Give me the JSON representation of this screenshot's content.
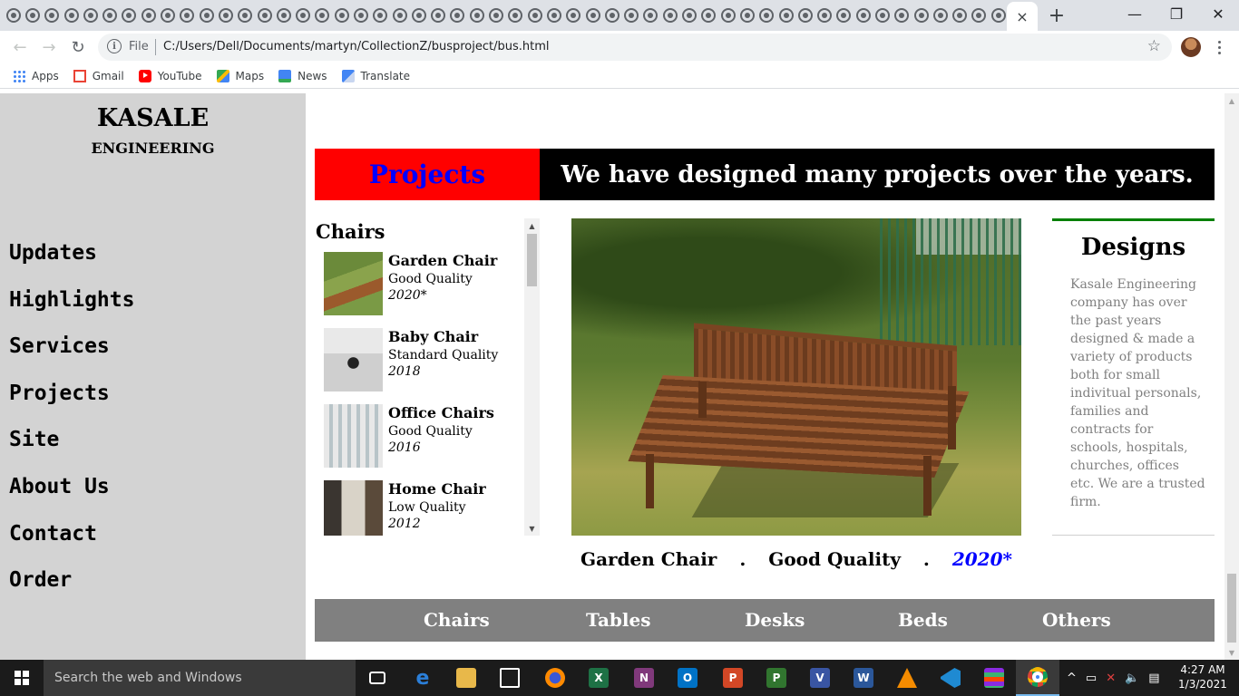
{
  "browser": {
    "active_tab_close": "×",
    "new_tab": "+",
    "minimize": "—",
    "restore": "❐",
    "close": "✕",
    "omnibox_scheme": "File",
    "url": "C:/Users/Dell/Documents/martyn/CollectionZ/busproject/bus.html",
    "star_icon": "☆",
    "back_icon": "←",
    "forward_icon": "→",
    "reload_icon": "↻",
    "info_icon": "i"
  },
  "bookmarks": [
    {
      "label": "Apps",
      "icon": "apps-icon"
    },
    {
      "label": "Gmail",
      "icon": "gmail-icon"
    },
    {
      "label": "YouTube",
      "icon": "youtube-icon"
    },
    {
      "label": "Maps",
      "icon": "maps-icon"
    },
    {
      "label": "News",
      "icon": "news-icon"
    },
    {
      "label": "Translate",
      "icon": "translate-icon"
    }
  ],
  "sidebar": {
    "brand_line1": "KASALE",
    "brand_line2": "ENGINEERING",
    "items": [
      "Updates",
      "Highlights",
      "Services",
      "Projects",
      "Site",
      "About Us",
      "Contact",
      "Order"
    ]
  },
  "banner": {
    "section": "Projects",
    "tagline": "We have designed many projects over the years."
  },
  "chairs": {
    "title": "Chairs",
    "items": [
      {
        "name": "Garden Chair",
        "quality": "Good Quality",
        "year": "2020*"
      },
      {
        "name": "Baby Chair",
        "quality": "Standard Quality",
        "year": "2018"
      },
      {
        "name": "Office Chairs",
        "quality": "Good Quality",
        "year": "2016"
      },
      {
        "name": "Home Chair",
        "quality": "Low Quality",
        "year": "2012"
      }
    ]
  },
  "caption": {
    "name": "Garden Chair",
    "sep1": ".",
    "quality": "Good Quality",
    "sep2": ".",
    "year": "2020*"
  },
  "designs": {
    "title": "Designs",
    "body": "Kasale Engineering company has over the past years designed & made a variety of products both for small indivitual personals, families and contracts for schools, hospitals, churches, offices etc. We are a trusted firm."
  },
  "bottom_nav": [
    "Chairs",
    "Tables",
    "Desks",
    "Beds",
    "Others"
  ],
  "taskbar": {
    "search_placeholder": "Search the web and Windows",
    "time": "4:27 AM",
    "date": "1/3/2021"
  },
  "colors": {
    "banner_red": "#ff0000",
    "banner_link_blue": "#0000ff",
    "sidebar_grey": "#d3d3d3",
    "bottom_nav_grey": "#808080",
    "designs_accent": "#008000"
  }
}
